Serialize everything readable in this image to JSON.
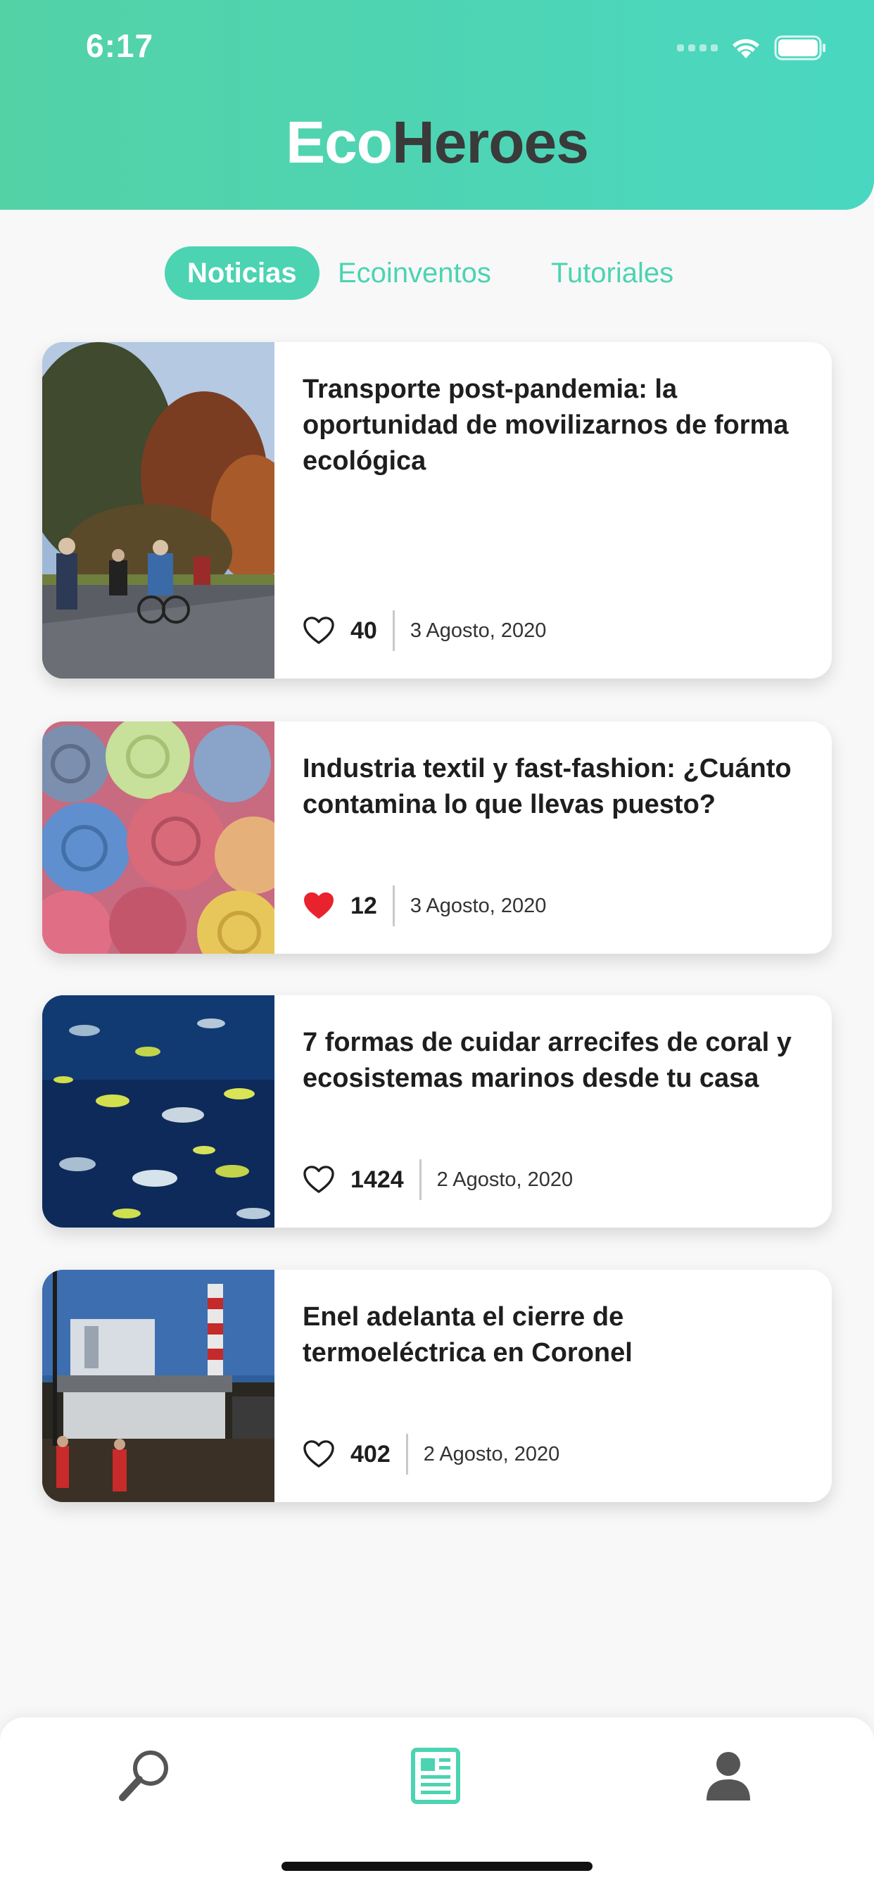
{
  "status_bar": {
    "time": "6:17"
  },
  "app": {
    "title_part1": "Eco",
    "title_part2": "Heroes"
  },
  "tabs": [
    {
      "label": "Noticias",
      "active": true
    },
    {
      "label": "Ecoinventos",
      "active": false
    },
    {
      "label": "Tutoriales",
      "active": false
    }
  ],
  "articles": [
    {
      "title": "Transporte post-pandemia: la oportunidad de movilizarnos de forma ecológica",
      "likes": "40",
      "liked": false,
      "date": "3 Agosto, 2020",
      "image": "cyclists-in-park-photo"
    },
    {
      "title": "Industria textil y fast-fashion: ¿Cuánto contamina lo que llevas puesto?",
      "likes": "12",
      "liked": true,
      "date": "3 Agosto, 2020",
      "image": "rolled-colorful-textiles-photo"
    },
    {
      "title": "7 formas de cuidar arrecifes de coral y ecosistemas marinos desde tu casa",
      "likes": "1424",
      "liked": false,
      "date": "2 Agosto, 2020",
      "image": "fish-school-underwater-photo"
    },
    {
      "title": "Enel adelanta el cierre de termoeléctrica en Coronel",
      "likes": "402",
      "liked": false,
      "date": "2 Agosto, 2020",
      "image": "power-plant-chimney-photo"
    }
  ],
  "bottom_nav": [
    {
      "icon": "search-icon",
      "active": false
    },
    {
      "icon": "newspaper-icon",
      "active": true
    },
    {
      "icon": "user-icon",
      "active": false
    }
  ],
  "colors": {
    "accent": "#4cd3b2",
    "header_start": "#53d2a6",
    "header_end": "#4ad7c1",
    "like_active": "#e8232d",
    "inactive_icon": "#555555"
  }
}
